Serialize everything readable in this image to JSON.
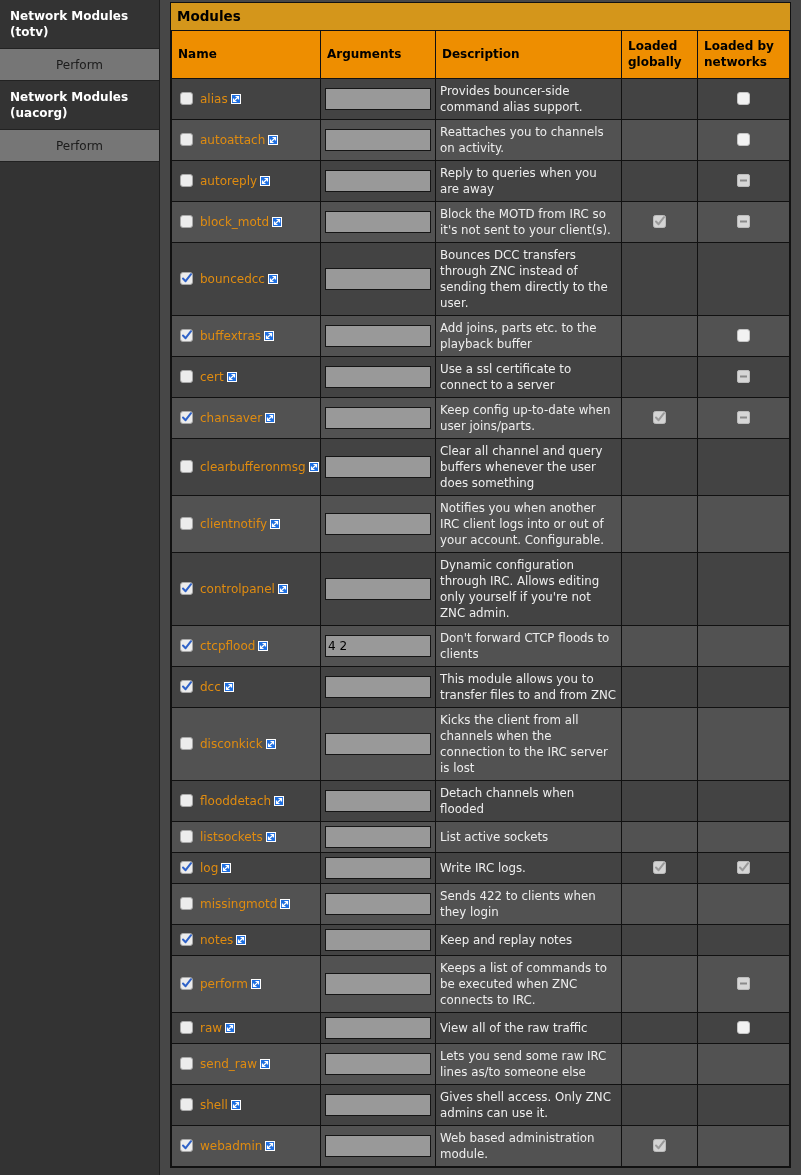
{
  "sidebar": {
    "sections": [
      {
        "title": "Network Modules (totv)",
        "button": "Perform"
      },
      {
        "title": "Network Modules (uacorg)",
        "button": "Perform"
      }
    ]
  },
  "panel": {
    "title": "Modules"
  },
  "table": {
    "columns": [
      "Name",
      "Arguments",
      "Description",
      "Loaded globally",
      "Loaded by networks"
    ],
    "rows": [
      {
        "name": "alias",
        "loaded": false,
        "description": "Provides bouncer-side command alias support.",
        "loaded_globally": false,
        "loaded_by_networks": {
          "checked": false,
          "indeterminate": false
        }
      },
      {
        "name": "autoattach",
        "loaded": false,
        "description": "Reattaches you to channels on activity.",
        "loaded_globally": false,
        "loaded_by_networks": {
          "checked": false,
          "indeterminate": false
        }
      },
      {
        "name": "autoreply",
        "loaded": false,
        "description": "Reply to queries when you are away",
        "loaded_globally": false,
        "loaded_by_networks": {
          "checked": false,
          "indeterminate": true
        }
      },
      {
        "name": "block_motd",
        "loaded": false,
        "description": "Block the MOTD from IRC so it's not sent to your client(s).",
        "loaded_globally": true,
        "loaded_by_networks": {
          "checked": false,
          "indeterminate": true
        }
      },
      {
        "name": "bouncedcc",
        "loaded": true,
        "description": "Bounces DCC transfers through ZNC instead of sending them directly to the user.",
        "loaded_globally": false
      },
      {
        "name": "buffextras",
        "loaded": true,
        "description": "Add joins, parts etc. to the playback buffer",
        "loaded_globally": false,
        "loaded_by_networks": {
          "checked": false,
          "indeterminate": false
        }
      },
      {
        "name": "cert",
        "loaded": false,
        "description": "Use a ssl certificate to connect to a server",
        "loaded_globally": false,
        "loaded_by_networks": {
          "checked": false,
          "indeterminate": true
        }
      },
      {
        "name": "chansaver",
        "loaded": true,
        "description": "Keep config up-to-date when user joins/parts.",
        "loaded_globally": true,
        "loaded_by_networks": {
          "checked": false,
          "indeterminate": true
        }
      },
      {
        "name": "clearbufferonmsg",
        "loaded": false,
        "description": "Clear all channel and query buffers whenever the user does something",
        "loaded_globally": false
      },
      {
        "name": "clientnotify",
        "loaded": false,
        "description": "Notifies you when another IRC client logs into or out of your account. Configurable.",
        "loaded_globally": false
      },
      {
        "name": "controlpanel",
        "loaded": true,
        "description": "Dynamic configuration through IRC. Allows editing only yourself if you're not ZNC admin.",
        "loaded_globally": false
      },
      {
        "name": "ctcpflood",
        "loaded": true,
        "arguments": "4 2",
        "description": "Don't forward CTCP floods to clients",
        "loaded_globally": false
      },
      {
        "name": "dcc",
        "loaded": true,
        "description": "This module allows you to transfer files to and from ZNC",
        "loaded_globally": false
      },
      {
        "name": "disconkick",
        "loaded": false,
        "description": "Kicks the client from all channels when the connection to the IRC server is lost",
        "loaded_globally": false
      },
      {
        "name": "flooddetach",
        "loaded": false,
        "description": "Detach channels when flooded",
        "loaded_globally": false
      },
      {
        "name": "listsockets",
        "loaded": false,
        "description": "List active sockets",
        "loaded_globally": false
      },
      {
        "name": "log",
        "loaded": true,
        "description": "Write IRC logs.",
        "loaded_globally": true,
        "loaded_by_networks": {
          "checked": true,
          "indeterminate": false
        }
      },
      {
        "name": "missingmotd",
        "loaded": false,
        "description": "Sends 422 to clients when they login",
        "loaded_globally": false
      },
      {
        "name": "notes",
        "loaded": true,
        "description": "Keep and replay notes",
        "loaded_globally": false
      },
      {
        "name": "perform",
        "loaded": true,
        "description": "Keeps a list of commands to be executed when ZNC connects to IRC.",
        "loaded_globally": false,
        "loaded_by_networks": {
          "checked": false,
          "indeterminate": true
        }
      },
      {
        "name": "raw",
        "loaded": false,
        "description": "View all of the raw traffic",
        "loaded_globally": false,
        "loaded_by_networks": {
          "checked": false,
          "indeterminate": false
        }
      },
      {
        "name": "send_raw",
        "loaded": false,
        "description": "Lets you send some raw IRC lines as/to someone else",
        "loaded_globally": false
      },
      {
        "name": "shell",
        "loaded": false,
        "description": "Gives shell access. Only ZNC admins can use it.",
        "loaded_globally": false
      },
      {
        "name": "webadmin",
        "loaded": true,
        "description": "Web based administration module.",
        "loaded_globally": true
      }
    ]
  }
}
